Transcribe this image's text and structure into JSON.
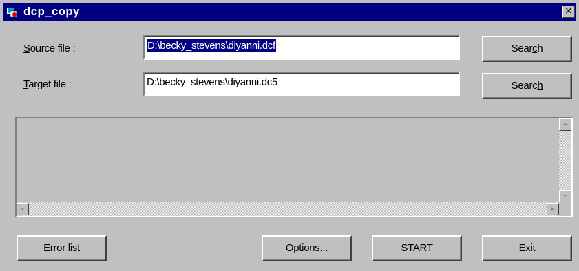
{
  "window": {
    "title": "dcp_copy",
    "close_glyph": "×"
  },
  "source": {
    "label_key": "S",
    "label_rest": "ource file :",
    "value": "D:\\becky_stevens\\diyanni.dcf",
    "search_pre": "Sear",
    "search_key": "c",
    "search_post": "h"
  },
  "target": {
    "label_key": "T",
    "label_rest": "arget file :",
    "value": "D:\\becky_stevens\\diyanni.dc5",
    "search_pre": "Searc",
    "search_key": "h",
    "search_post": ""
  },
  "buttons": {
    "error_pre": "E",
    "error_key": "r",
    "error_post": "ror list",
    "options_key": "O",
    "options_post": "ptions...",
    "start_pre": "ST",
    "start_key": "A",
    "start_post": "RT",
    "exit_key": "E",
    "exit_post": "xit"
  },
  "icons": {
    "app": "app-icon",
    "close": "close-icon",
    "scroll_up": "arrow-up-icon",
    "scroll_down": "arrow-down-icon",
    "scroll_left": "arrow-left-icon",
    "scroll_right": "arrow-right-icon"
  },
  "colors": {
    "titlebar": "#000080",
    "face": "#c0c0c0",
    "selection": "#000080"
  }
}
